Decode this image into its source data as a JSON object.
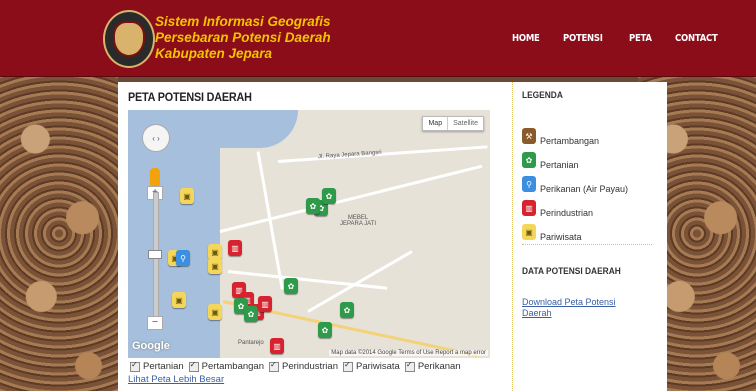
{
  "header": {
    "title_lines": [
      "Sistem Informasi Geografis",
      "Persebaran Potensi Daerah",
      "Kabupaten Jepara"
    ],
    "nav": [
      "HOME",
      "POTENSI",
      "PETA",
      "CONTACT"
    ]
  },
  "main": {
    "title": "PETA POTENSI DAERAH",
    "map": {
      "type_buttons": [
        "Map",
        "Satellite"
      ],
      "labels": [
        "Jl. Raya Jepara Bangsri",
        "MEBEL JEPARA JATI",
        "Pantarejo"
      ],
      "google": "Google",
      "attribution": "Map data ©2014 Google  Terms of Use  Report a map error"
    },
    "filters": [
      "Pertanian",
      "Pertambangan",
      "Perindustrian",
      "Pariwisata",
      "Perikanan"
    ],
    "bigger_map_link": "Lihat Peta Lebih Besar"
  },
  "sidebar": {
    "legend_title": "LEGENDA",
    "legend": [
      {
        "label": "Pertambangan",
        "color": "#8b5a2b",
        "icon": "mining-icon"
      },
      {
        "label": "Pertanian",
        "color": "#2f9a4a",
        "icon": "farming-icon"
      },
      {
        "label": "Perikanan (Air Payau)",
        "color": "#3c8fe0",
        "icon": "fish-icon"
      },
      {
        "label": "Perindustrian",
        "color": "#d6232f",
        "icon": "factory-icon"
      },
      {
        "label": "Pariwisata",
        "color": "#f4d65a",
        "icon": "tourism-icon"
      }
    ],
    "data_title": "DATA POTENSI DAERAH",
    "download_link": "Download Peta Potensi Daerah"
  }
}
